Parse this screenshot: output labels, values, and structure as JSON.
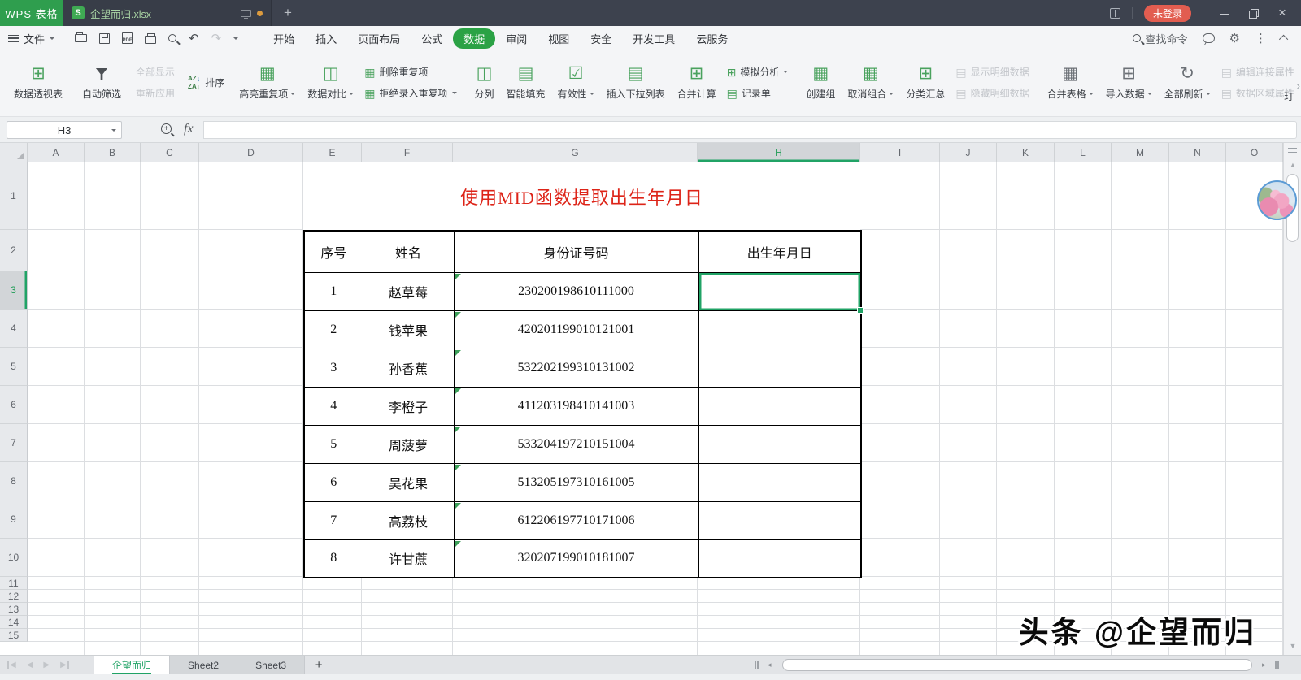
{
  "titlebar": {
    "app": "WPS 表格",
    "doc_tab": "企望而归.xlsx",
    "file_icon_letter": "S",
    "new_tab": "+",
    "login": "未登录"
  },
  "menubar": {
    "file": "文件",
    "menus": [
      {
        "label": "开始"
      },
      {
        "label": "插入"
      },
      {
        "label": "页面布局"
      },
      {
        "label": "公式"
      },
      {
        "label": "数据",
        "active": true
      },
      {
        "label": "审阅"
      },
      {
        "label": "视图"
      },
      {
        "label": "安全"
      },
      {
        "label": "开发工具"
      },
      {
        "label": "云服务"
      }
    ],
    "find_command": "查找命令"
  },
  "ribbon": {
    "pivot": "数据透视表",
    "autofilter": "自动筛选",
    "show_all": "全部显示",
    "reapply": "重新应用",
    "sort": "排序",
    "highlight_dup": "高亮重复项",
    "data_compare": "数据对比",
    "remove_dup": "删除重复项",
    "reject_dup": "拒绝录入重复项",
    "text_to_cols": "分列",
    "smart_fill": "智能填充",
    "validation": "有效性",
    "dropdown_list": "插入下拉列表",
    "consolidate": "合并计算",
    "what_if": "模拟分析",
    "record_form": "记录单",
    "group": "创建组",
    "ungroup": "取消组合",
    "subtotal": "分类汇总",
    "show_detail": "显示明细数据",
    "hide_detail": "隐藏明细数据",
    "merge_sheets": "合并表格",
    "import_data": "导入数据",
    "refresh_all": "全部刷新",
    "edit_links": "编辑连接属性",
    "range_props": "数据区域属性",
    "clipped": "玎"
  },
  "formulabar": {
    "name_box": "H3",
    "fx": "fx",
    "formula": ""
  },
  "grid": {
    "columns": [
      "A",
      "B",
      "C",
      "D",
      "E",
      "F",
      "G",
      "H",
      "I",
      "J",
      "K",
      "L",
      "M",
      "N",
      "O"
    ],
    "rows": [
      "1",
      "2",
      "3",
      "4",
      "5",
      "6",
      "7",
      "8",
      "9",
      "10",
      "11",
      "12",
      "13",
      "14",
      "15"
    ],
    "selected_column": "H",
    "selected_row": "3",
    "selected_cell": "H3"
  },
  "sheet": {
    "title": "使用MID函数提取出生年月日",
    "headers": [
      "序号",
      "姓名",
      "身份证号码",
      "出生年月日"
    ],
    "rows": [
      {
        "no": "1",
        "name": "赵草莓",
        "id": "230200198610111000",
        "birth": ""
      },
      {
        "no": "2",
        "name": "钱苹果",
        "id": "420201199010121001",
        "birth": ""
      },
      {
        "no": "3",
        "name": "孙香蕉",
        "id": "532202199310131002",
        "birth": ""
      },
      {
        "no": "4",
        "name": "李橙子",
        "id": "411203198410141003",
        "birth": ""
      },
      {
        "no": "5",
        "name": "周菠萝",
        "id": "533204197210151004",
        "birth": ""
      },
      {
        "no": "6",
        "name": "吴花果",
        "id": "513205197310161005",
        "birth": ""
      },
      {
        "no": "7",
        "name": "高荔枝",
        "id": "612206197710171006",
        "birth": ""
      },
      {
        "no": "8",
        "name": "许甘蔗",
        "id": "320207199010181007",
        "birth": ""
      }
    ]
  },
  "tabs": {
    "sheets": [
      {
        "label": "企望而归",
        "active": true
      },
      {
        "label": "Sheet2"
      },
      {
        "label": "Sheet3"
      }
    ],
    "add": "+"
  },
  "watermark": "头条 @企望而归",
  "icons": {
    "grid": "⊞",
    "grid2": "▦",
    "split": "◫",
    "rows": "▤",
    "check": "☑",
    "refresh": "↻",
    "funnel_small": "▽",
    "undo": "↶",
    "redo": "↷",
    "dots": "⋮",
    "gear": "⚙",
    "arrow_down": "↓",
    "sort_a": "A",
    "sort_z": "Z",
    "chev_right": "›",
    "close": "×",
    "nav_left": "◀",
    "nav_right": "▶",
    "tri_up": "▲",
    "tri_down": "▼",
    "h_left": "◂",
    "h_right": "▸",
    "pdf": "PDF"
  },
  "colors": {
    "accent_green": "#21a366",
    "brand_green": "#2f9e4e",
    "menu_pill_green": "#2ba245",
    "badge_red": "#e25d50",
    "title_red": "#dd2418",
    "titlebar_bg": "#3d424e"
  }
}
